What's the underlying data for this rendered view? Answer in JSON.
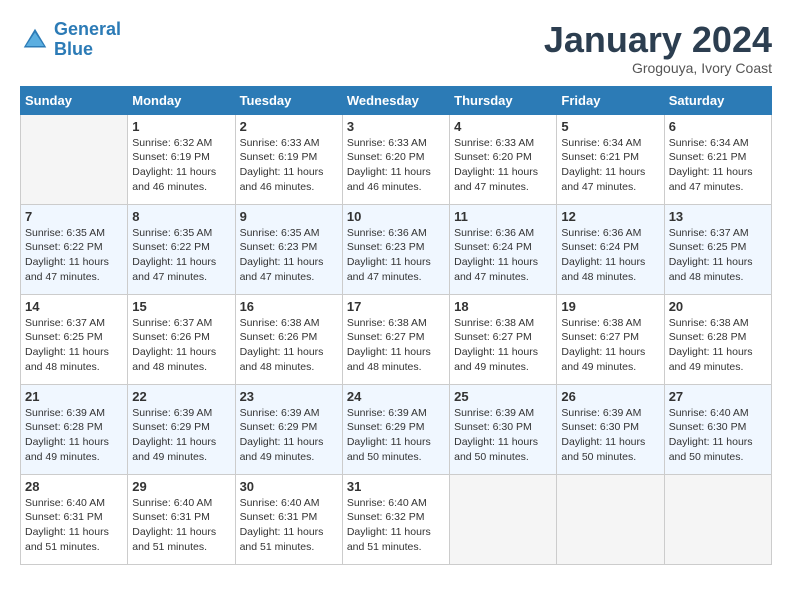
{
  "logo": {
    "text_general": "General",
    "text_blue": "Blue"
  },
  "title": "January 2024",
  "subtitle": "Grogouya, Ivory Coast",
  "days_of_week": [
    "Sunday",
    "Monday",
    "Tuesday",
    "Wednesday",
    "Thursday",
    "Friday",
    "Saturday"
  ],
  "weeks": [
    [
      {
        "day": "",
        "info": ""
      },
      {
        "day": "1",
        "info": "Sunrise: 6:32 AM\nSunset: 6:19 PM\nDaylight: 11 hours\nand 46 minutes."
      },
      {
        "day": "2",
        "info": "Sunrise: 6:33 AM\nSunset: 6:19 PM\nDaylight: 11 hours\nand 46 minutes."
      },
      {
        "day": "3",
        "info": "Sunrise: 6:33 AM\nSunset: 6:20 PM\nDaylight: 11 hours\nand 46 minutes."
      },
      {
        "day": "4",
        "info": "Sunrise: 6:33 AM\nSunset: 6:20 PM\nDaylight: 11 hours\nand 47 minutes."
      },
      {
        "day": "5",
        "info": "Sunrise: 6:34 AM\nSunset: 6:21 PM\nDaylight: 11 hours\nand 47 minutes."
      },
      {
        "day": "6",
        "info": "Sunrise: 6:34 AM\nSunset: 6:21 PM\nDaylight: 11 hours\nand 47 minutes."
      }
    ],
    [
      {
        "day": "7",
        "info": "Sunrise: 6:35 AM\nSunset: 6:22 PM\nDaylight: 11 hours\nand 47 minutes."
      },
      {
        "day": "8",
        "info": "Sunrise: 6:35 AM\nSunset: 6:22 PM\nDaylight: 11 hours\nand 47 minutes."
      },
      {
        "day": "9",
        "info": "Sunrise: 6:35 AM\nSunset: 6:23 PM\nDaylight: 11 hours\nand 47 minutes."
      },
      {
        "day": "10",
        "info": "Sunrise: 6:36 AM\nSunset: 6:23 PM\nDaylight: 11 hours\nand 47 minutes."
      },
      {
        "day": "11",
        "info": "Sunrise: 6:36 AM\nSunset: 6:24 PM\nDaylight: 11 hours\nand 47 minutes."
      },
      {
        "day": "12",
        "info": "Sunrise: 6:36 AM\nSunset: 6:24 PM\nDaylight: 11 hours\nand 48 minutes."
      },
      {
        "day": "13",
        "info": "Sunrise: 6:37 AM\nSunset: 6:25 PM\nDaylight: 11 hours\nand 48 minutes."
      }
    ],
    [
      {
        "day": "14",
        "info": "Sunrise: 6:37 AM\nSunset: 6:25 PM\nDaylight: 11 hours\nand 48 minutes."
      },
      {
        "day": "15",
        "info": "Sunrise: 6:37 AM\nSunset: 6:26 PM\nDaylight: 11 hours\nand 48 minutes."
      },
      {
        "day": "16",
        "info": "Sunrise: 6:38 AM\nSunset: 6:26 PM\nDaylight: 11 hours\nand 48 minutes."
      },
      {
        "day": "17",
        "info": "Sunrise: 6:38 AM\nSunset: 6:27 PM\nDaylight: 11 hours\nand 48 minutes."
      },
      {
        "day": "18",
        "info": "Sunrise: 6:38 AM\nSunset: 6:27 PM\nDaylight: 11 hours\nand 49 minutes."
      },
      {
        "day": "19",
        "info": "Sunrise: 6:38 AM\nSunset: 6:27 PM\nDaylight: 11 hours\nand 49 minutes."
      },
      {
        "day": "20",
        "info": "Sunrise: 6:38 AM\nSunset: 6:28 PM\nDaylight: 11 hours\nand 49 minutes."
      }
    ],
    [
      {
        "day": "21",
        "info": "Sunrise: 6:39 AM\nSunset: 6:28 PM\nDaylight: 11 hours\nand 49 minutes."
      },
      {
        "day": "22",
        "info": "Sunrise: 6:39 AM\nSunset: 6:29 PM\nDaylight: 11 hours\nand 49 minutes."
      },
      {
        "day": "23",
        "info": "Sunrise: 6:39 AM\nSunset: 6:29 PM\nDaylight: 11 hours\nand 49 minutes."
      },
      {
        "day": "24",
        "info": "Sunrise: 6:39 AM\nSunset: 6:29 PM\nDaylight: 11 hours\nand 50 minutes."
      },
      {
        "day": "25",
        "info": "Sunrise: 6:39 AM\nSunset: 6:30 PM\nDaylight: 11 hours\nand 50 minutes."
      },
      {
        "day": "26",
        "info": "Sunrise: 6:39 AM\nSunset: 6:30 PM\nDaylight: 11 hours\nand 50 minutes."
      },
      {
        "day": "27",
        "info": "Sunrise: 6:40 AM\nSunset: 6:30 PM\nDaylight: 11 hours\nand 50 minutes."
      }
    ],
    [
      {
        "day": "28",
        "info": "Sunrise: 6:40 AM\nSunset: 6:31 PM\nDaylight: 11 hours\nand 51 minutes."
      },
      {
        "day": "29",
        "info": "Sunrise: 6:40 AM\nSunset: 6:31 PM\nDaylight: 11 hours\nand 51 minutes."
      },
      {
        "day": "30",
        "info": "Sunrise: 6:40 AM\nSunset: 6:31 PM\nDaylight: 11 hours\nand 51 minutes."
      },
      {
        "day": "31",
        "info": "Sunrise: 6:40 AM\nSunset: 6:32 PM\nDaylight: 11 hours\nand 51 minutes."
      },
      {
        "day": "",
        "info": ""
      },
      {
        "day": "",
        "info": ""
      },
      {
        "day": "",
        "info": ""
      }
    ]
  ]
}
